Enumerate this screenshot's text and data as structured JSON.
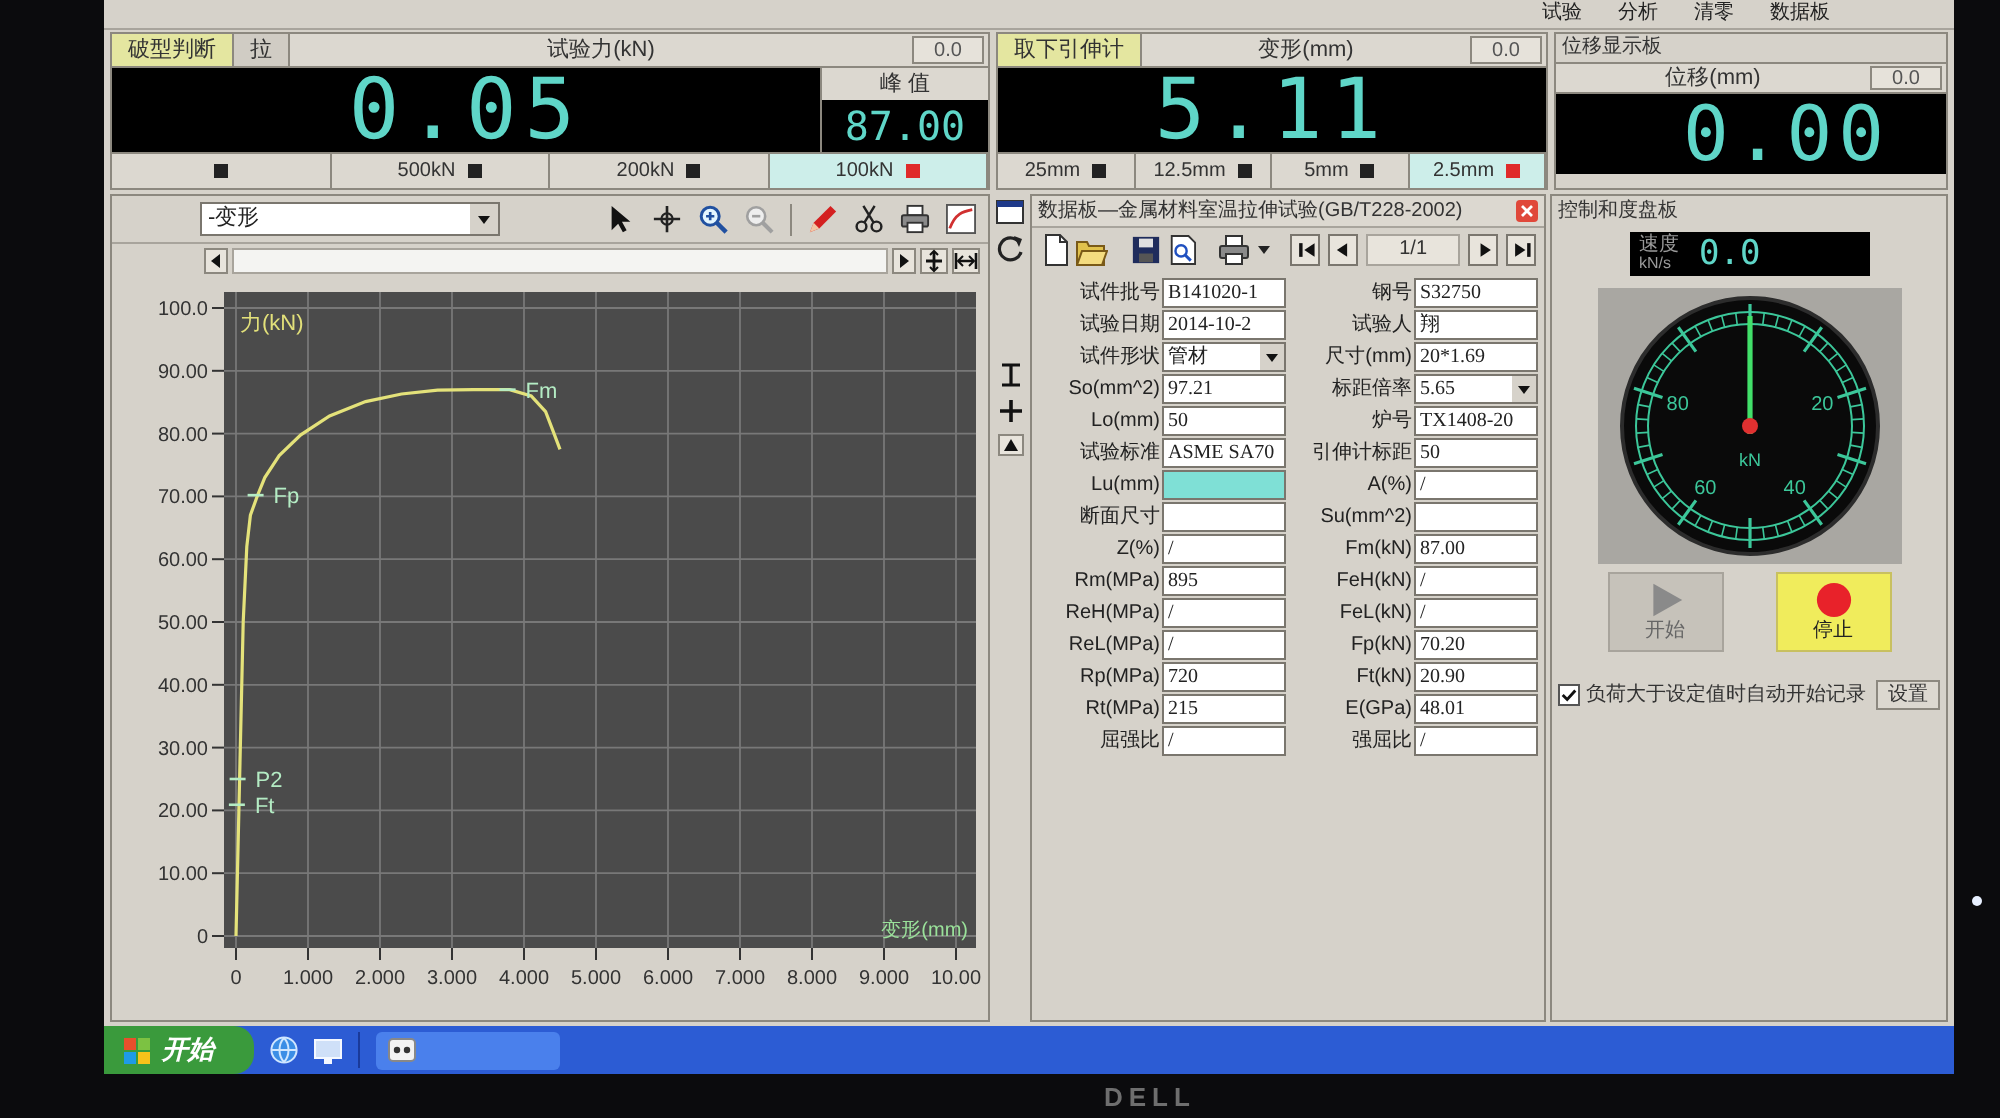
{
  "monitor": {
    "logo": "DELL"
  },
  "toolbar": [
    "试验",
    "分析",
    "清零",
    "数据板"
  ],
  "force_panel": {
    "indicators": [
      {
        "text": "破型判断",
        "highlighted": true
      },
      {
        "text": "拉",
        "highlighted": false
      }
    ],
    "title": "试验力(kN)",
    "zero": "0.0",
    "reading": "0.05",
    "peak_label": "峰 值",
    "peak": "87.00",
    "ranges": [
      {
        "selected": false
      },
      {
        "label": "500kN",
        "selected": false
      },
      {
        "label": "200kN",
        "selected": false
      },
      {
        "label": "100kN",
        "selected": true
      }
    ]
  },
  "extensometer_panel": {
    "indicators": [
      {
        "text": "取下引伸计",
        "highlighted": true
      }
    ],
    "title": "变形(mm)",
    "zero": "0.0",
    "reading": "5.11",
    "ranges": [
      {
        "label": "25mm",
        "selected": false
      },
      {
        "label": "12.5mm",
        "selected": false
      },
      {
        "label": "5mm",
        "selected": false
      },
      {
        "label": "2.5mm",
        "selected": true
      }
    ]
  },
  "displacement_panel": {
    "panel_title": "位移显示板",
    "title": "位移(mm)",
    "zero": "0.0",
    "reading": "0.00"
  },
  "chart_panel": {
    "curve_select": "-变形",
    "chart_data": {
      "type": "line",
      "xlabel": "变形(mm)",
      "ylabel": "力(kN)",
      "x": [
        0,
        0.05,
        0.1,
        0.15,
        0.2,
        0.3,
        0.4,
        0.6,
        0.9,
        1.3,
        1.8,
        2.3,
        2.8,
        3.3,
        3.8,
        4.1,
        4.3,
        4.4,
        4.5
      ],
      "series": [
        {
          "color": "#e4e27a",
          "values": [
            0,
            25,
            50,
            62,
            67,
            70.2,
            73,
            76.5,
            79.8,
            82.8,
            85.1,
            86.3,
            86.9,
            87.0,
            87.0,
            86.0,
            83.5,
            80.5,
            77.5
          ]
        }
      ],
      "xlim": [
        0,
        10
      ],
      "ylim": [
        0,
        100
      ],
      "xticks": [
        {
          "value": 0,
          "label": "0"
        },
        {
          "value": 1,
          "label": "1.000"
        },
        {
          "value": 2,
          "label": "2.000"
        },
        {
          "value": 3,
          "label": "3.000"
        },
        {
          "value": 4,
          "label": "4.000"
        },
        {
          "value": 5,
          "label": "5.000"
        },
        {
          "value": 6,
          "label": "6.000"
        },
        {
          "value": 7,
          "label": "7.000"
        },
        {
          "value": 8,
          "label": "8.000"
        },
        {
          "value": 9,
          "label": "9.000"
        },
        {
          "value": 10,
          "label": "10.00"
        }
      ],
      "yticks": [
        {
          "value": 0,
          "label": "0"
        },
        {
          "value": 10,
          "label": "10.00"
        },
        {
          "value": 20,
          "label": "20.00"
        },
        {
          "value": 30,
          "label": "30.00"
        },
        {
          "value": 40,
          "label": "40.00"
        },
        {
          "value": 50,
          "label": "50.00"
        },
        {
          "value": 60,
          "label": "60.00"
        },
        {
          "value": 70,
          "label": "70.00"
        },
        {
          "value": 80,
          "label": "80.00"
        },
        {
          "value": 90,
          "label": "90.00"
        },
        {
          "value": 100,
          "label": "100.0"
        }
      ],
      "grid": true,
      "annotations": [
        {
          "x": 3.8,
          "y": 87.0,
          "text": "Fm"
        },
        {
          "x": 0.3,
          "y": 70.2,
          "text": "Fp"
        },
        {
          "x": 0.05,
          "y": 25,
          "text": "P2"
        },
        {
          "x": 0.04,
          "y": 20.9,
          "text": "Ft"
        }
      ]
    }
  },
  "data_panel": {
    "title": "数据板—金属材料室温拉伸试验(GB/T228-2002)",
    "page": "1/1",
    "left_fields": [
      {
        "label": "试件批号",
        "value": "B141020-1",
        "kind": "text",
        "focused": false
      },
      {
        "label": "试验日期",
        "value": "2014-10-2",
        "kind": "text",
        "focused": false
      },
      {
        "label": "试件形状",
        "value": "管材",
        "kind": "dropdown",
        "focused": false
      },
      {
        "label": "So(mm^2)",
        "value": "97.21",
        "kind": "text",
        "focused": false
      },
      {
        "label": "Lo(mm)",
        "value": "50",
        "kind": "text",
        "focused": false
      },
      {
        "label": "试验标准",
        "value": "ASME SA70",
        "kind": "text",
        "focused": false
      },
      {
        "label": "Lu(mm)",
        "kind": "text",
        "focused": true
      },
      {
        "label": "断面尺寸",
        "kind": "text",
        "focused": false
      },
      {
        "label": "Z(%)",
        "value": "/",
        "kind": "text",
        "focused": false
      },
      {
        "label": "Rm(MPa)",
        "value": "895",
        "kind": "text",
        "focused": false
      },
      {
        "label": "ReH(MPa)",
        "value": "/",
        "kind": "text",
        "focused": false
      },
      {
        "label": "ReL(MPa)",
        "value": "/",
        "kind": "text",
        "focused": false
      },
      {
        "label": "Rp(MPa)",
        "value": "720",
        "kind": "text",
        "focused": false
      },
      {
        "label": "Rt(MPa)",
        "value": "215",
        "kind": "text",
        "focused": false
      },
      {
        "label": "屈强比",
        "value": "/",
        "kind": "text",
        "focused": false
      }
    ],
    "right_fields": [
      {
        "label": "钢号",
        "value": "S32750",
        "kind": "text",
        "focused": false
      },
      {
        "label": "试验人",
        "value": "翔",
        "kind": "text",
        "focused": false
      },
      {
        "label": "尺寸(mm)",
        "value": "20*1.69",
        "kind": "text",
        "focused": false
      },
      {
        "label": "标距倍率",
        "value": "5.65",
        "kind": "dropdown",
        "focused": false
      },
      {
        "label": "炉号",
        "value": "TX1408-20",
        "kind": "text",
        "focused": false
      },
      {
        "label": "引伸计标距",
        "value": "50",
        "kind": "text",
        "focused": false
      },
      {
        "label": "A(%)",
        "value": "/",
        "kind": "text",
        "focused": false
      },
      {
        "label": "Su(mm^2)",
        "kind": "text",
        "focused": false
      },
      {
        "label": "Fm(kN)",
        "value": "87.00",
        "kind": "text",
        "focused": false
      },
      {
        "label": "FeH(kN)",
        "value": "/",
        "kind": "text",
        "focused": false
      },
      {
        "label": "FeL(kN)",
        "value": "/",
        "kind": "text",
        "focused": false
      },
      {
        "label": "Fp(kN)",
        "value": "70.20",
        "kind": "text",
        "focused": false
      },
      {
        "label": "Ft(kN)",
        "value": "20.90",
        "kind": "text",
        "focused": false
      },
      {
        "label": "E(GPa)",
        "value": "48.01",
        "kind": "text",
        "focused": false
      },
      {
        "label": "强屈比",
        "value": "/",
        "kind": "text",
        "focused": false
      }
    ]
  },
  "control_panel": {
    "title": "控制和度盘板",
    "speed_label": "速度",
    "speed_unit": "kN/s",
    "speed": "0.0",
    "dial": {
      "labels": [
        "20",
        "40",
        "60",
        "80"
      ],
      "unit": "kN"
    },
    "buttons": [
      {
        "label": "开始",
        "kind": "start",
        "disabled": true
      },
      {
        "label": "停止",
        "kind": "stop",
        "disabled": false
      }
    ],
    "auto_record": {
      "label": "负荷大于设定值时自动开始记录",
      "checked": true
    },
    "settings_button": "设置"
  },
  "taskbar": {
    "start": "开始"
  }
}
